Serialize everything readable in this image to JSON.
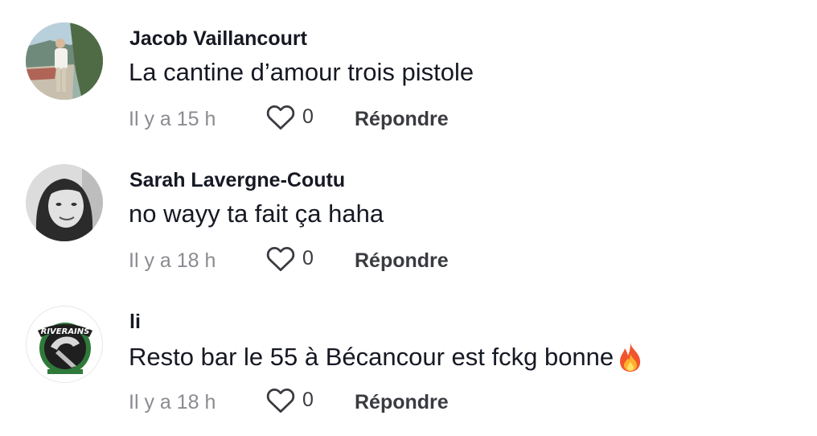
{
  "comments": [
    {
      "username": "Jacob Vaillancourt",
      "text": "La cantine d’amour trois pistole",
      "time": "Il y a 15 h",
      "likes": "0",
      "reply_label": "Répondre",
      "emoji": ""
    },
    {
      "username": "Sarah Lavergne-Coutu",
      "text": "no wayy ta fait ça haha",
      "time": "Il y a 18 h",
      "likes": "0",
      "reply_label": "Répondre",
      "emoji": ""
    },
    {
      "username": "li",
      "text": "Resto bar le 55 à Bécancour est fckg bonne",
      "time": "Il y a 18 h",
      "likes": "0",
      "reply_label": "Répondre",
      "emoji": "fire-emoji",
      "avatar_logo_text": "RIVERAINS"
    }
  ],
  "colors": {
    "text": "#161823",
    "meta": "#8a8b91",
    "secondary": "#3a3b40"
  },
  "icons": {
    "like": "heart-outline-icon",
    "emoji": "fire-emoji"
  }
}
